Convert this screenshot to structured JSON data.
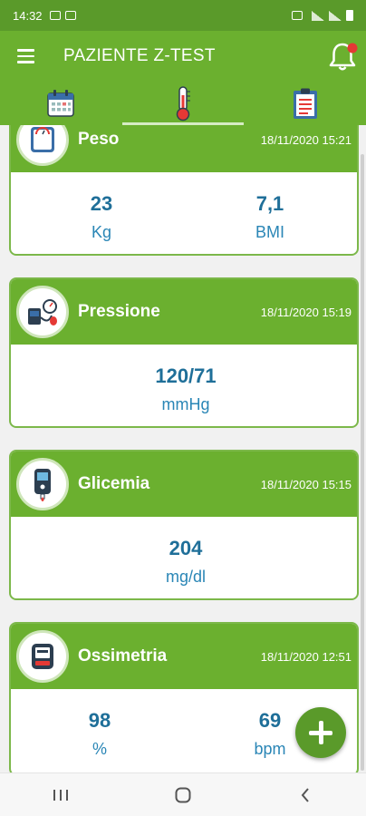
{
  "status_bar": {
    "time": "14:32"
  },
  "app_bar": {
    "title": "PAZIENTE Z-TEST"
  },
  "tabs": [
    {
      "name": "calendar-tab",
      "icon": "calendar-icon",
      "active": false
    },
    {
      "name": "measurements-tab",
      "icon": "thermometer-icon",
      "active": true
    },
    {
      "name": "clipboard-tab",
      "icon": "clipboard-icon",
      "active": false
    }
  ],
  "cards": [
    {
      "name": "Peso",
      "date": "18/11/2020 15:21",
      "icon": "scale-icon",
      "values": [
        {
          "value": "23",
          "unit": "Kg"
        },
        {
          "value": "7,1",
          "unit": "BMI"
        }
      ]
    },
    {
      "name": "Pressione",
      "date": "18/11/2020 15:19",
      "icon": "blood-pressure-icon",
      "values": [
        {
          "value": "120/71",
          "unit": "mmHg"
        }
      ]
    },
    {
      "name": "Glicemia",
      "date": "18/11/2020 15:15",
      "icon": "glucometer-icon",
      "values": [
        {
          "value": "204",
          "unit": "mg/dl"
        }
      ]
    },
    {
      "name": "Ossimetria",
      "date": "18/11/2020 12:51",
      "icon": "oximeter-icon",
      "values": [
        {
          "value": "98",
          "unit": "%"
        },
        {
          "value": "69",
          "unit": "bpm"
        }
      ]
    }
  ],
  "colors": {
    "primary": "#6bb02f",
    "dark_primary": "#5a9a2a",
    "value_blue": "#1f6f99",
    "notification_dot": "#e53935"
  }
}
